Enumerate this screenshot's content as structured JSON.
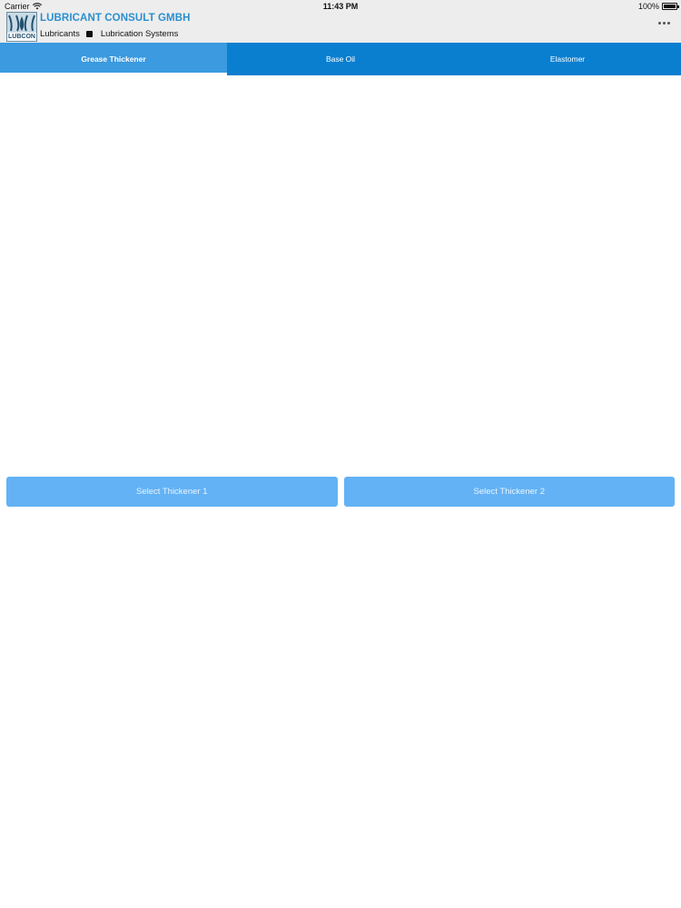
{
  "status_bar": {
    "carrier": "Carrier",
    "time": "11:43 PM",
    "battery_percent": "100%",
    "battery_level": 1.0
  },
  "header": {
    "logo_text": "LUBCON",
    "company_name": "LUBRICANT CONSULT GMBH",
    "tagline_left": "Lubricants",
    "tagline_right": "Lubrication Systems",
    "more_icon": "ellipsis-icon"
  },
  "tabs": [
    {
      "label": "Grease Thickener",
      "active": true
    },
    {
      "label": "Base Oil",
      "active": false
    },
    {
      "label": "Elastomer",
      "active": false
    }
  ],
  "actions": {
    "select_1": "Select Thickener 1",
    "select_2": "Select Thickener 2"
  },
  "colors": {
    "header_bg": "#ededed",
    "company_name": "#2a8fd0",
    "tab_bar": "#0a7fd0",
    "tab_active": "#3b9ae0",
    "button_bg": "#63b2f5"
  }
}
